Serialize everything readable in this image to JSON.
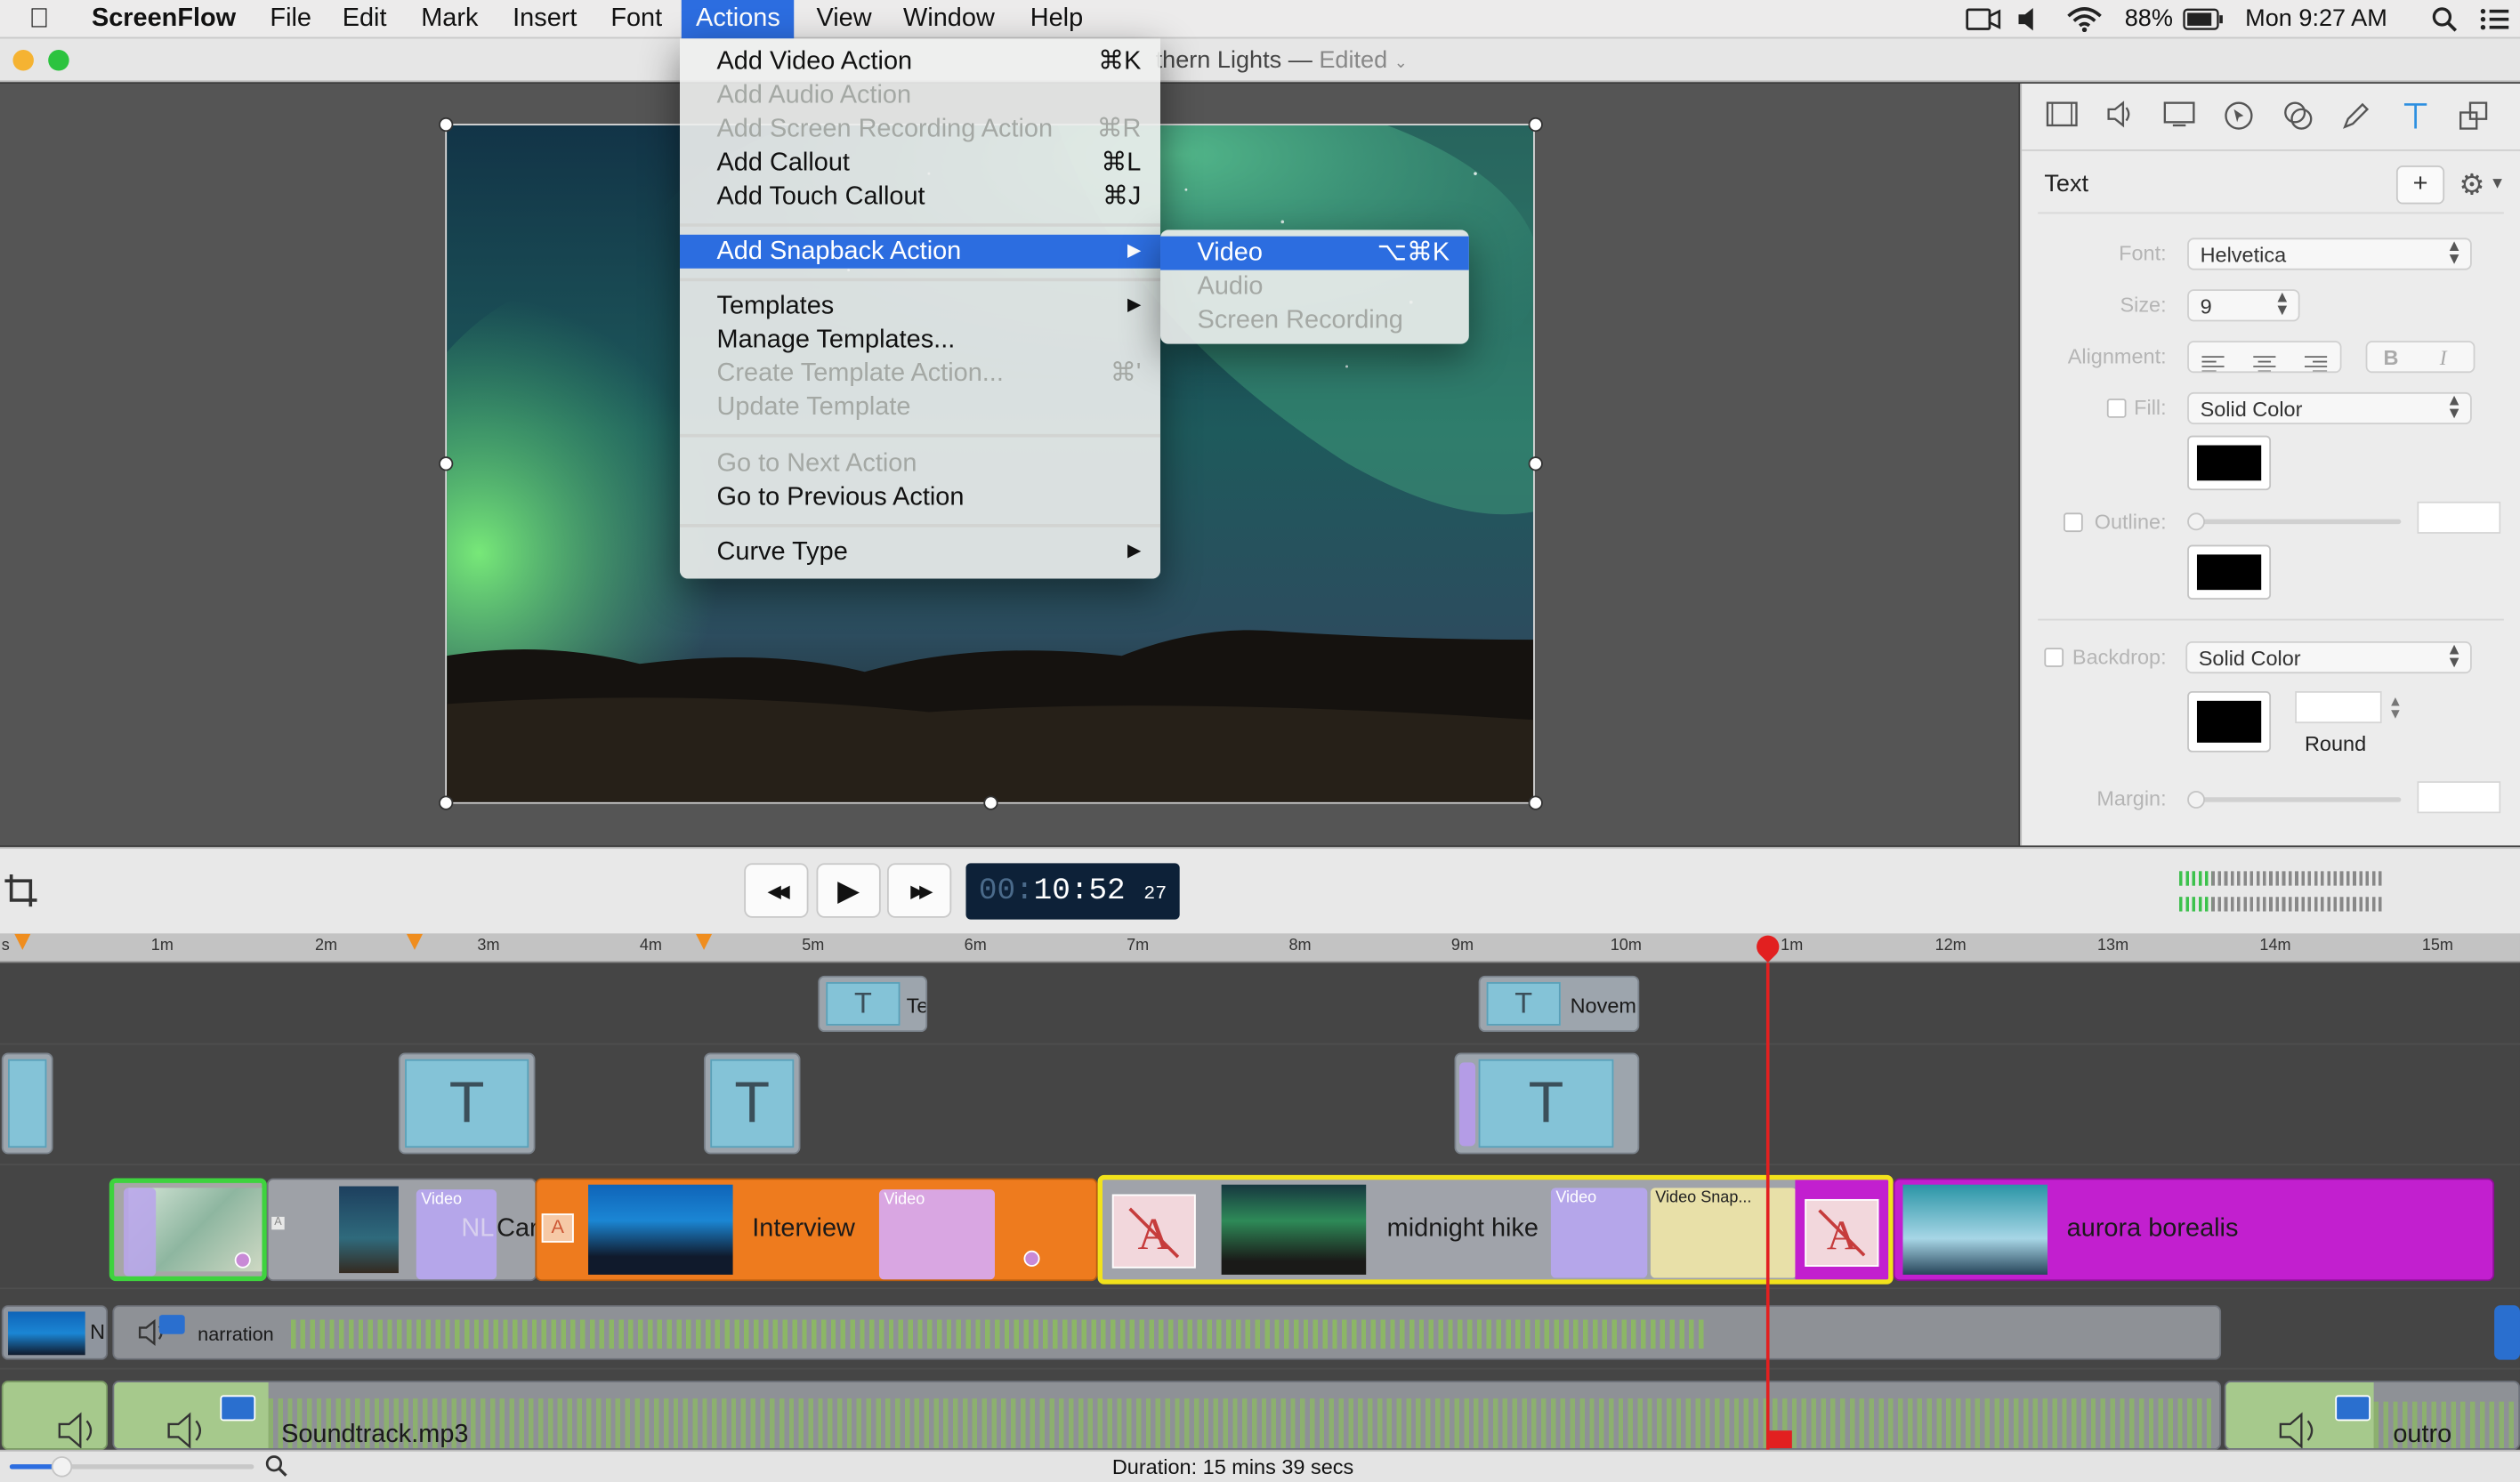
{
  "menubar": {
    "app": "ScreenFlow",
    "menus": [
      "File",
      "Edit",
      "Mark",
      "Insert",
      "Font",
      "Actions",
      "View",
      "Window",
      "Help"
    ],
    "battery": "88%",
    "clock": "Mon 9:27 AM"
  },
  "window": {
    "title": "thern Lights",
    "separator": "—",
    "edited": "Edited"
  },
  "actions_menu": {
    "items": [
      {
        "label": "Add Video Action",
        "shortcut": "⌘K",
        "enabled": true
      },
      {
        "label": "Add Audio Action",
        "shortcut": "",
        "enabled": false
      },
      {
        "label": "Add Screen Recording Action",
        "shortcut": "⌘R",
        "enabled": false
      },
      {
        "label": "Add Callout",
        "shortcut": "⌘L",
        "enabled": true
      },
      {
        "label": "Add Touch Callout",
        "shortcut": "⌘J",
        "enabled": true
      },
      {
        "label": "Add Snapback Action",
        "shortcut": "▶",
        "enabled": true,
        "highlighted": true
      },
      {
        "label": "Templates",
        "shortcut": "▶",
        "enabled": true
      },
      {
        "label": "Manage Templates...",
        "shortcut": "",
        "enabled": true
      },
      {
        "label": "Create Template Action...",
        "shortcut": "⌘'",
        "enabled": false
      },
      {
        "label": "Update Template",
        "shortcut": "",
        "enabled": false
      },
      {
        "label": "Go to Next Action",
        "shortcut": "",
        "enabled": false
      },
      {
        "label": "Go to Previous Action",
        "shortcut": "",
        "enabled": true
      },
      {
        "label": "Curve Type",
        "shortcut": "▶",
        "enabled": true
      }
    ]
  },
  "snapback_submenu": {
    "items": [
      {
        "label": "Video",
        "shortcut": "⌥⌘K",
        "enabled": true,
        "highlighted": true
      },
      {
        "label": "Audio",
        "shortcut": "",
        "enabled": false
      },
      {
        "label": "Screen Recording",
        "shortcut": "",
        "enabled": false
      }
    ]
  },
  "inspector": {
    "section": "Text",
    "add_label": "+",
    "gear": "⚙",
    "font_label": "Font:",
    "font_value": "Helvetica",
    "size_label": "Size:",
    "size_value": "9",
    "alignment_label": "Alignment:",
    "bold": "B",
    "italic": "I",
    "fill_label": "Fill:",
    "fill_value": "Solid Color",
    "fill_color": "#000000",
    "outline_label": "Outline:",
    "outline_color": "#000000",
    "backdrop_label": "Backdrop:",
    "backdrop_value": "Solid Color",
    "backdrop_color": "#000000",
    "round_label": "Round",
    "margin_label": "Margin:"
  },
  "transport": {
    "rewind": "◀◀",
    "play": "▶",
    "forward": "▶▶",
    "timecode_dim": "00:",
    "timecode": "10:52",
    "timecode_frames": "27"
  },
  "ruler": {
    "ticks": [
      "s",
      "1m",
      "2m",
      "3m",
      "4m",
      "5m",
      "6m",
      "7m",
      "8m",
      "9m",
      "10m",
      "1m",
      "12m",
      "13m",
      "14m",
      "15m"
    ]
  },
  "clips": {
    "text_top": [
      "Te",
      "Novem"
    ],
    "text_icon": "T",
    "video_tag": "Video",
    "snap_tag": "Video Snap...",
    "nl": "NL",
    "car": "Car",
    "interview": "Interview",
    "midnight": "midnight hike",
    "aurora": "aurora borealis",
    "narration": "narration",
    "n": "N",
    "soundtrack": "Soundtrack.mp3",
    "outro": "outro",
    "a_badge": "A"
  },
  "status": {
    "duration": "Duration: 15 mins 39 secs"
  },
  "colors": {
    "accent": "#2c6de0",
    "orange_clip": "#ee7b1e",
    "purple_clip": "#c21fcf",
    "selection": "#f2e21b",
    "audio": "#8bbd5e",
    "playhead": "#e22020"
  }
}
